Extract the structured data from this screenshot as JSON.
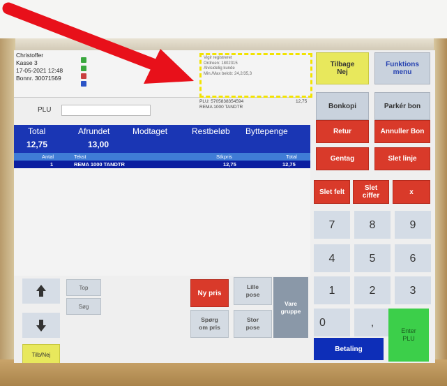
{
  "info": {
    "user": "Christoffer",
    "register": "Kasse 3",
    "datetime": "17-05-2021 12:48",
    "receipt_no": "Bonnr. 30071569",
    "message_lines": "Vigir registreret\nOrdreen: 1802315\nAlvisidelig kunde\nMin./Max belob: 24,2/35,3"
  },
  "plu": {
    "label": "PLU",
    "value": "",
    "placeholder": "",
    "code_line1": "PLU: 5705838354594",
    "code_line2": "REMA 1000 TANDTR",
    "code_price": "12,75"
  },
  "totals": {
    "headers": [
      "Total",
      "Afrundet",
      "Modtaget",
      "Restbeløb",
      "Byttepenge"
    ],
    "total": "12,75",
    "rounded": "13,00"
  },
  "table": {
    "columns": [
      "Antal",
      "Tekst",
      "Stkpris",
      "Total"
    ],
    "rows": [
      {
        "qty": "1",
        "text": "REMA 1000 TANDTR",
        "unit_price": "12,75",
        "total": "12,75"
      }
    ]
  },
  "side_buttons": {
    "back_no": "Tilbage\nNej",
    "functions_menu": "Funktions\nmenu",
    "receipt_copy": "Bonkopi",
    "park_receipt": "Parkér bon",
    "return": "Retur",
    "cancel_receipt": "Annuller Bon",
    "repeat": "Gentag",
    "delete_line": "Slet linje",
    "delete_field": "Slet felt",
    "delete_digit": "Slet\nciffer",
    "clear": "x",
    "enter_plu": "Enter\nPLU",
    "payment": "Betaling"
  },
  "keypad": [
    "7",
    "8",
    "9",
    "4",
    "5",
    "6",
    "1",
    "2",
    "3",
    "0",
    ","
  ],
  "bottom_buttons": {
    "top": "Top",
    "search": "Søg",
    "back_no": "Tilb/Nej",
    "new_price": "Ny pris",
    "small_bag": "Lille\npose",
    "large_bag": "Stor\npose",
    "ask_price": "Spørg\nom pris",
    "product_group": "Vare\ngruppe"
  },
  "colors": {
    "totals_bar": "#1a36b4",
    "red_button": "#d93a2a",
    "highlight_box": "#f2e300",
    "annotation_arrow": "#e8101a"
  },
  "icons": {
    "scroll_up": "arrow-up-icon",
    "scroll_down": "arrow-down-icon",
    "annotation_arrow": "red-arrow"
  }
}
